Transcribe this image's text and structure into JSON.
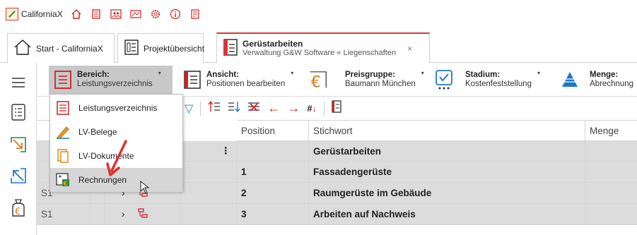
{
  "app": {
    "name": "CaliforniaX"
  },
  "titlebar_icons": [
    "home-icon",
    "document-list-icon",
    "people-icon",
    "map-icon",
    "gear-icon",
    "info-icon",
    "notes-icon"
  ],
  "tabs": [
    {
      "label": "Start - CaliforniaX"
    },
    {
      "label": "Projektübersicht"
    },
    {
      "title": "Gerüstarbeiten",
      "subtitle": "Verwaltung G&W Software « Liegenschaften",
      "close": "×"
    }
  ],
  "ribbon": {
    "bereich": {
      "title": "Bereich:",
      "value": "Leistungsverzeichnis"
    },
    "ansicht": {
      "title": "Ansicht:",
      "value": "Positionen bearbeiten"
    },
    "preisgruppe": {
      "title": "Preisgruppe:",
      "value": "Baumann München"
    },
    "stadium": {
      "title": "Stadium:",
      "value": "Kostenfeststellung"
    },
    "menge": {
      "title": "Menge:",
      "value": "Abrechnung"
    }
  },
  "dropdown": {
    "items": [
      {
        "label": "Leistungsverzeichnis"
      },
      {
        "label": "LV-Belege"
      },
      {
        "label": "LV-Dokumente"
      },
      {
        "label": "Rechnungen"
      }
    ]
  },
  "grid": {
    "headers": {
      "position": "Position",
      "stichwort": "Stichwort",
      "menge": "Menge"
    },
    "rows": [
      {
        "prefix": "",
        "position": "",
        "stichwort": "Gerüstarbeiten",
        "menu": "⋮"
      },
      {
        "prefix": "",
        "position": "1",
        "stichwort": "Fassadengerüste"
      },
      {
        "prefix": "S1",
        "position": "2",
        "stichwort": "Raumgerüste im Gebäude",
        "expander": "›"
      },
      {
        "prefix": "S1",
        "position": "3",
        "stichwort": "Arbeiten auf Nachweis",
        "expander": "›"
      }
    ]
  },
  "colors": {
    "accent": "#d33030",
    "hover": "#d6d6d6",
    "active_group": "#c8c8c8",
    "row_gray": "#dcdcdc",
    "blue_icon": "#1e78c8"
  }
}
